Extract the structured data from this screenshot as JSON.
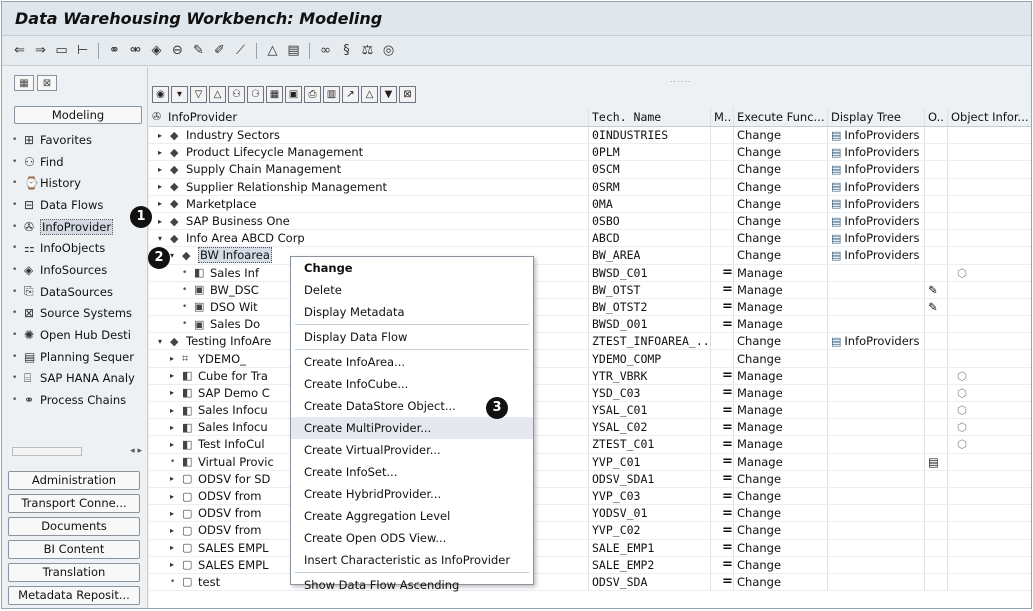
{
  "window": {
    "title": "Data Warehousing Workbench: Modeling"
  },
  "toolbar": {
    "icons": [
      "back-arrow-icon",
      "forward-arrow-icon",
      "window-icon",
      "hierarchy-icon",
      "glasses-icon",
      "glasses-pair-icon",
      "cube-icon",
      "cylinder-icon",
      "pencil-icon",
      "edit-doc-icon",
      "wand-icon",
      "triangle-icon",
      "doc-list-icon",
      "infinity-icon",
      "symbol-icon",
      "scale-icon",
      "target-icon"
    ]
  },
  "left": {
    "modeling_label": "Modeling",
    "nav": [
      {
        "label": "Favorites",
        "icon": "star-box-icon",
        "glyph": "⊞"
      },
      {
        "label": "Find",
        "icon": "binoculars-icon",
        "glyph": "⚇"
      },
      {
        "label": "History",
        "icon": "history-icon",
        "glyph": "⌚"
      },
      {
        "label": "Data Flows",
        "icon": "dataflow-icon",
        "glyph": "⊟"
      },
      {
        "label": "InfoProvider",
        "icon": "infoprovider-icon",
        "glyph": "✇"
      },
      {
        "label": "InfoObjects",
        "icon": "infoobjects-icon",
        "glyph": "⚏"
      },
      {
        "label": "InfoSources",
        "icon": "infosources-icon",
        "glyph": "◈"
      },
      {
        "label": "DataSources",
        "icon": "datasources-icon",
        "glyph": "⎘"
      },
      {
        "label": "Source Systems",
        "icon": "source-systems-icon",
        "glyph": "⊠"
      },
      {
        "label": "Open Hub Desti",
        "icon": "open-hub-icon",
        "glyph": "✺"
      },
      {
        "label": "Planning Sequer",
        "icon": "planning-icon",
        "glyph": "▤"
      },
      {
        "label": "SAP HANA Analy",
        "icon": "hana-icon",
        "glyph": "⌸"
      },
      {
        "label": "Process Chains",
        "icon": "process-chains-icon",
        "glyph": "⚭"
      }
    ],
    "bottom_buttons": [
      "Administration",
      "Transport Conne...",
      "Documents",
      "BI Content",
      "Translation",
      "Metadata Reposit..."
    ]
  },
  "grid": {
    "headers": [
      "InfoProvider",
      "Tech. Name",
      "M..",
      "Execute Func...",
      "Display Tree",
      "O..",
      "Object Infor..."
    ],
    "rows": [
      {
        "indent": 0,
        "tri": "▸",
        "icon": "◆",
        "name": "Industry Sectors",
        "tech": "0INDUSTRIES",
        "m": "",
        "exec": "Change",
        "tree": "InfoProviders",
        "o": "",
        "info": ""
      },
      {
        "indent": 0,
        "tri": "▸",
        "icon": "◆",
        "name": "Product Lifecycle Management",
        "tech": "0PLM",
        "m": "",
        "exec": "Change",
        "tree": "InfoProviders",
        "o": "",
        "info": ""
      },
      {
        "indent": 0,
        "tri": "▸",
        "icon": "◆",
        "name": "Supply Chain Management",
        "tech": "0SCM",
        "m": "",
        "exec": "Change",
        "tree": "InfoProviders",
        "o": "",
        "info": ""
      },
      {
        "indent": 0,
        "tri": "▸",
        "icon": "◆",
        "name": "Supplier Relationship Management",
        "tech": "0SRM",
        "m": "",
        "exec": "Change",
        "tree": "InfoProviders",
        "o": "",
        "info": ""
      },
      {
        "indent": 0,
        "tri": "▸",
        "icon": "◆",
        "name": "Marketplace",
        "tech": "0MA",
        "m": "",
        "exec": "Change",
        "tree": "InfoProviders",
        "o": "",
        "info": ""
      },
      {
        "indent": 0,
        "tri": "▸",
        "icon": "◆",
        "name": "SAP Business One",
        "tech": "0SBO",
        "m": "",
        "exec": "Change",
        "tree": "InfoProviders",
        "o": "",
        "info": ""
      },
      {
        "indent": 0,
        "tri": "▾",
        "icon": "◆",
        "name": "Info Area ABCD Corp",
        "tech": "ABCD",
        "m": "",
        "exec": "Change",
        "tree": "InfoProviders",
        "o": "",
        "info": ""
      },
      {
        "indent": 1,
        "tri": "▾",
        "icon": "◆",
        "name": "BW Infoarea",
        "tech": "BW_AREA",
        "m": "",
        "exec": "Change",
        "tree": "InfoProviders",
        "o": "",
        "info": "",
        "highlight": true
      },
      {
        "indent": 2,
        "tri": "•",
        "icon": "◧",
        "name": "Sales Inf",
        "tech": "BWSD_C01",
        "m": "=",
        "exec": "Manage",
        "tree": "",
        "o": "",
        "info": "⬡"
      },
      {
        "indent": 2,
        "tri": "•",
        "icon": "▣",
        "name": "BW_DSC",
        "tech": "BW_OTST",
        "m": "=",
        "exec": "Manage",
        "tree": "",
        "o": "✎",
        "info": ""
      },
      {
        "indent": 2,
        "tri": "•",
        "icon": "▣",
        "name": "DSO Wit",
        "tech": "BW_OTST2",
        "m": "=",
        "exec": "Manage",
        "tree": "",
        "o": "✎",
        "info": ""
      },
      {
        "indent": 2,
        "tri": "•",
        "icon": "▣",
        "name": "Sales Do",
        "tech": "BWSD_O01",
        "m": "=",
        "exec": "Manage",
        "tree": "",
        "o": "",
        "info": ""
      },
      {
        "indent": 0,
        "tri": "▾",
        "icon": "◆",
        "name": "Testing InfoAre",
        "tech": "ZTEST_INFOAREA_...",
        "m": "",
        "exec": "Change",
        "tree": "InfoProviders",
        "o": "",
        "info": ""
      },
      {
        "indent": 1,
        "tri": "▸",
        "icon": "⌗",
        "name": "YDEMO_",
        "tech": "YDEMO_COMP",
        "m": "",
        "exec": "Change",
        "tree": "",
        "o": "",
        "info": ""
      },
      {
        "indent": 1,
        "tri": "▸",
        "icon": "◧",
        "name": "Cube for Tra",
        "tech": "YTR_VBRK",
        "m": "=",
        "exec": "Manage",
        "tree": "",
        "o": "",
        "info": "⬡"
      },
      {
        "indent": 1,
        "tri": "▸",
        "icon": "◧",
        "name": "SAP Demo C",
        "tech": "YSD_C03",
        "m": "=",
        "exec": "Manage",
        "tree": "",
        "o": "",
        "info": "⬡"
      },
      {
        "indent": 1,
        "tri": "▸",
        "icon": "◧",
        "name": "Sales Infocu",
        "tech": "YSAL_C01",
        "m": "=",
        "exec": "Manage",
        "tree": "",
        "o": "",
        "info": "⬡"
      },
      {
        "indent": 1,
        "tri": "▸",
        "icon": "◧",
        "name": "Sales Infocu",
        "tech": "YSAL_C02",
        "m": "=",
        "exec": "Manage",
        "tree": "",
        "o": "",
        "info": "⬡"
      },
      {
        "indent": 1,
        "tri": "▸",
        "icon": "◧",
        "name": "Test InfoCul",
        "tech": "ZTEST_C01",
        "m": "=",
        "exec": "Manage",
        "tree": "",
        "o": "",
        "info": "⬡"
      },
      {
        "indent": 1,
        "tri": "•",
        "icon": "◧",
        "name": "Virtual Provic",
        "tech": "YVP_C01",
        "m": "=",
        "exec": "Manage",
        "tree": "",
        "o": "▤",
        "info": ""
      },
      {
        "indent": 1,
        "tri": "▸",
        "icon": "▢",
        "name": "ODSV for SD",
        "tech": "ODSV_SDA1",
        "m": "=",
        "exec": "Change",
        "tree": "",
        "o": "",
        "info": ""
      },
      {
        "indent": 1,
        "tri": "▸",
        "icon": "▢",
        "name": "ODSV from",
        "tech": "YVP_C03",
        "m": "=",
        "exec": "Change",
        "tree": "",
        "o": "",
        "info": ""
      },
      {
        "indent": 1,
        "tri": "▸",
        "icon": "▢",
        "name": "ODSV from",
        "tech": "YODSV_01",
        "m": "=",
        "exec": "Change",
        "tree": "",
        "o": "",
        "info": ""
      },
      {
        "indent": 1,
        "tri": "▸",
        "icon": "▢",
        "name": "ODSV from",
        "tech": "YVP_C02",
        "m": "=",
        "exec": "Change",
        "tree": "",
        "o": "",
        "info": ""
      },
      {
        "indent": 1,
        "tri": "▸",
        "icon": "▢",
        "name": "SALES EMPL",
        "tech": "SALE_EMP1",
        "m": "=",
        "exec": "Change",
        "tree": "",
        "o": "",
        "info": ""
      },
      {
        "indent": 1,
        "tri": "▸",
        "icon": "▢",
        "name": "SALES EMPL",
        "tech": "SALE_EMP2",
        "m": "=",
        "exec": "Change",
        "tree": "",
        "o": "",
        "info": ""
      },
      {
        "indent": 1,
        "tri": "•",
        "icon": "▢",
        "name": "test",
        "tech": "ODSV_SDA",
        "m": "=",
        "exec": "Change",
        "tree": "",
        "o": "",
        "info": ""
      }
    ]
  },
  "context_menu": {
    "items": [
      {
        "label": "Change",
        "bold": true
      },
      {
        "label": "Delete"
      },
      {
        "label": "Display Metadata",
        "sep_after": true
      },
      {
        "label": "Display Data Flow",
        "sep_after": true
      },
      {
        "label": "Create InfoArea..."
      },
      {
        "label": "Create InfoCube..."
      },
      {
        "label": "Create DataStore Object..."
      },
      {
        "label": "Create MultiProvider...",
        "hover": true
      },
      {
        "label": "Create VirtualProvider..."
      },
      {
        "label": "Create InfoSet..."
      },
      {
        "label": "Create HybridProvider..."
      },
      {
        "label": "Create Aggregation Level"
      },
      {
        "label": "Create Open ODS View..."
      },
      {
        "label": "Insert Characteristic as InfoProvider",
        "sep_after": true
      },
      {
        "label": "Show Data Flow Ascending"
      }
    ]
  },
  "callouts": [
    "1",
    "2",
    "3"
  ]
}
